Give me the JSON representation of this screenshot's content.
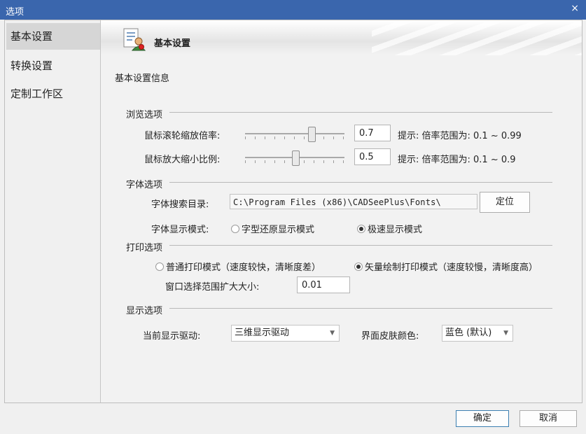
{
  "window": {
    "title": "选项",
    "close_glyph": "×"
  },
  "sidebar": {
    "items": [
      {
        "label": "基本设置",
        "active": true
      },
      {
        "label": "转换设置",
        "active": false
      },
      {
        "label": "定制工作区",
        "active": false
      }
    ]
  },
  "banner": {
    "title": "基本设置",
    "icon": "settings-user-icon"
  },
  "main": {
    "subtitle": "基本设置信息",
    "browse": {
      "header": "浏览选项",
      "wheel_label": "鼠标滚轮缩放倍率:",
      "wheel_value": "0.7",
      "wheel_hint": "提示: 倍率范围为: 0.1 ~ 0.99",
      "wheel_slider_fraction": 0.68,
      "zoom_label": "鼠标放大缩小比例:",
      "zoom_value": "0.5",
      "zoom_hint": "提示: 倍率范围为: 0.1 ~ 0.9",
      "zoom_slider_fraction": 0.5
    },
    "font": {
      "header": "字体选项",
      "dir_label": "字体搜索目录:",
      "dir_value": "C:\\Program Files (x86)\\CADSeePlus\\Fonts\\",
      "locate_label": "定位",
      "mode_label": "字体显示模式:",
      "mode_option1": "字型还原显示模式",
      "mode_option2": "极速显示模式",
      "selected": 2
    },
    "print": {
      "header": "打印选项",
      "option1": "普通打印模式（速度较快，清晰度差）",
      "option2": "矢量绘制打印模式（速度较慢，清晰度高）",
      "selected": 2,
      "window_label": "窗口选择范围扩大大小:",
      "window_value": "0.01"
    },
    "display": {
      "header": "显示选项",
      "driver_label": "当前显示驱动:",
      "driver_value": "三维显示驱动",
      "skin_label": "界面皮肤颜色:",
      "skin_value": "蓝色 (默认)"
    }
  },
  "footer": {
    "ok_label": "确定",
    "cancel_label": "取消"
  },
  "colors": {
    "titlebar": "#3a66ad",
    "primary_border": "#3c7fb1"
  }
}
